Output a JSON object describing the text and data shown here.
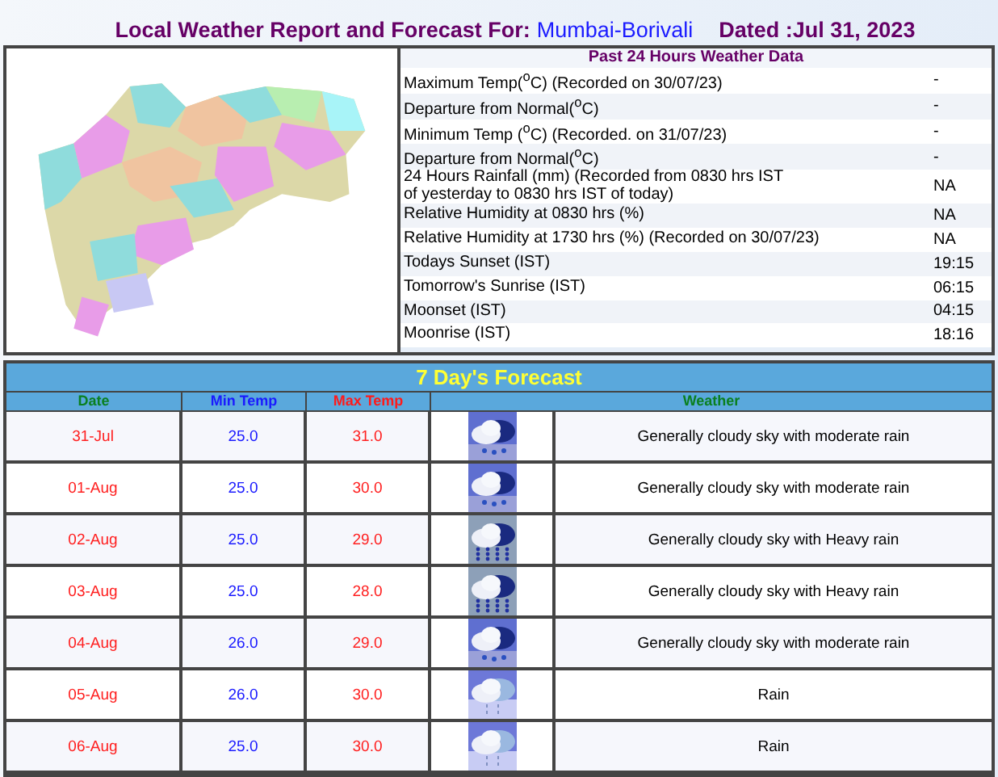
{
  "title": {
    "label": "Local Weather Report and Forecast For:",
    "place": "Mumbai-Borivali",
    "dated": "Dated :Jul 31, 2023"
  },
  "past24": {
    "heading": "Past 24 Hours Weather Data",
    "rows": [
      {
        "label": "Maximum Temp($^{o}$C) (Recorded on 30/07/23)",
        "value": "-"
      },
      {
        "label": "Departure from Normal($^{o}$C)",
        "value": "-"
      },
      {
        "label": "Minimum Temp ($^{o}$C) (Recorded. on 31/07/23)",
        "value": "-"
      },
      {
        "label": "Departure from Normal($^{o}$C)",
        "value": "-"
      },
      {
        "label": "24 Hours Rainfall (mm) (Recorded from 0830 hrs IST\nof yesterday to 0830 hrs IST of today)",
        "value": "NA"
      },
      {
        "label": "Relative Humidity at 0830 hrs (%)",
        "value": "NA"
      },
      {
        "label": "Relative Humidity at 1730 hrs (%) (Recorded on 30/07/23)",
        "value": "NA"
      },
      {
        "label": "Todays Sunset (IST)",
        "value": "19:15"
      },
      {
        "label": "Tomorrow's Sunrise (IST)",
        "value": "06:15"
      },
      {
        "label": "Moonset (IST)",
        "value": "04:15"
      },
      {
        "label": "Moonrise (IST)",
        "value": "18:16"
      }
    ]
  },
  "forecast": {
    "heading": "7 Day's Forecast",
    "columns": [
      "Date",
      "Min Temp",
      "Max Temp",
      "Weather"
    ],
    "rows": [
      {
        "date": "31-Jul",
        "min": "25.0",
        "max": "31.0",
        "kind": "moderate",
        "weather": "Generally cloudy sky with moderate rain"
      },
      {
        "date": "01-Aug",
        "min": "25.0",
        "max": "30.0",
        "kind": "moderate",
        "weather": "Generally cloudy sky with moderate rain"
      },
      {
        "date": "02-Aug",
        "min": "25.0",
        "max": "29.0",
        "kind": "heavy",
        "weather": "Generally cloudy sky with Heavy rain"
      },
      {
        "date": "03-Aug",
        "min": "25.0",
        "max": "28.0",
        "kind": "heavy",
        "weather": "Generally cloudy sky with Heavy rain"
      },
      {
        "date": "04-Aug",
        "min": "26.0",
        "max": "29.0",
        "kind": "moderate",
        "weather": "Generally cloudy sky with moderate rain"
      },
      {
        "date": "05-Aug",
        "min": "26.0",
        "max": "30.0",
        "kind": "light",
        "weather": "Rain"
      },
      {
        "date": "06-Aug",
        "min": "25.0",
        "max": "30.0",
        "kind": "light",
        "weather": "Rain"
      }
    ]
  }
}
